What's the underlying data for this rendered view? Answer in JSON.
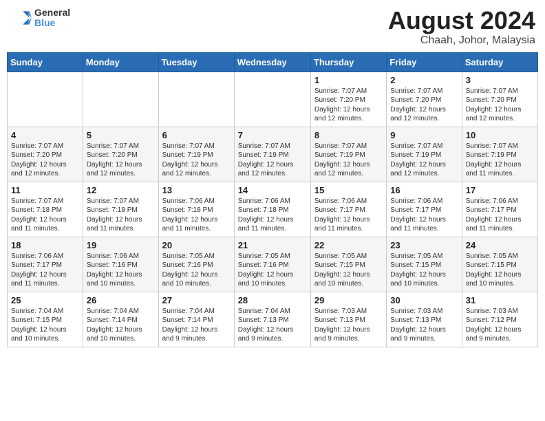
{
  "header": {
    "logo_line1": "General",
    "logo_line2": "Blue",
    "month": "August 2024",
    "location": "Chaah, Johor, Malaysia"
  },
  "weekdays": [
    "Sunday",
    "Monday",
    "Tuesday",
    "Wednesday",
    "Thursday",
    "Friday",
    "Saturday"
  ],
  "weeks": [
    [
      {
        "day": "",
        "info": ""
      },
      {
        "day": "",
        "info": ""
      },
      {
        "day": "",
        "info": ""
      },
      {
        "day": "",
        "info": ""
      },
      {
        "day": "1",
        "info": "Sunrise: 7:07 AM\nSunset: 7:20 PM\nDaylight: 12 hours\nand 12 minutes."
      },
      {
        "day": "2",
        "info": "Sunrise: 7:07 AM\nSunset: 7:20 PM\nDaylight: 12 hours\nand 12 minutes."
      },
      {
        "day": "3",
        "info": "Sunrise: 7:07 AM\nSunset: 7:20 PM\nDaylight: 12 hours\nand 12 minutes."
      }
    ],
    [
      {
        "day": "4",
        "info": "Sunrise: 7:07 AM\nSunset: 7:20 PM\nDaylight: 12 hours\nand 12 minutes."
      },
      {
        "day": "5",
        "info": "Sunrise: 7:07 AM\nSunset: 7:20 PM\nDaylight: 12 hours\nand 12 minutes."
      },
      {
        "day": "6",
        "info": "Sunrise: 7:07 AM\nSunset: 7:19 PM\nDaylight: 12 hours\nand 12 minutes."
      },
      {
        "day": "7",
        "info": "Sunrise: 7:07 AM\nSunset: 7:19 PM\nDaylight: 12 hours\nand 12 minutes."
      },
      {
        "day": "8",
        "info": "Sunrise: 7:07 AM\nSunset: 7:19 PM\nDaylight: 12 hours\nand 12 minutes."
      },
      {
        "day": "9",
        "info": "Sunrise: 7:07 AM\nSunset: 7:19 PM\nDaylight: 12 hours\nand 12 minutes."
      },
      {
        "day": "10",
        "info": "Sunrise: 7:07 AM\nSunset: 7:19 PM\nDaylight: 12 hours\nand 11 minutes."
      }
    ],
    [
      {
        "day": "11",
        "info": "Sunrise: 7:07 AM\nSunset: 7:18 PM\nDaylight: 12 hours\nand 11 minutes."
      },
      {
        "day": "12",
        "info": "Sunrise: 7:07 AM\nSunset: 7:18 PM\nDaylight: 12 hours\nand 11 minutes."
      },
      {
        "day": "13",
        "info": "Sunrise: 7:06 AM\nSunset: 7:18 PM\nDaylight: 12 hours\nand 11 minutes."
      },
      {
        "day": "14",
        "info": "Sunrise: 7:06 AM\nSunset: 7:18 PM\nDaylight: 12 hours\nand 11 minutes."
      },
      {
        "day": "15",
        "info": "Sunrise: 7:06 AM\nSunset: 7:17 PM\nDaylight: 12 hours\nand 11 minutes."
      },
      {
        "day": "16",
        "info": "Sunrise: 7:06 AM\nSunset: 7:17 PM\nDaylight: 12 hours\nand 11 minutes."
      },
      {
        "day": "17",
        "info": "Sunrise: 7:06 AM\nSunset: 7:17 PM\nDaylight: 12 hours\nand 11 minutes."
      }
    ],
    [
      {
        "day": "18",
        "info": "Sunrise: 7:06 AM\nSunset: 7:17 PM\nDaylight: 12 hours\nand 11 minutes."
      },
      {
        "day": "19",
        "info": "Sunrise: 7:06 AM\nSunset: 7:16 PM\nDaylight: 12 hours\nand 10 minutes."
      },
      {
        "day": "20",
        "info": "Sunrise: 7:05 AM\nSunset: 7:16 PM\nDaylight: 12 hours\nand 10 minutes."
      },
      {
        "day": "21",
        "info": "Sunrise: 7:05 AM\nSunset: 7:16 PM\nDaylight: 12 hours\nand 10 minutes."
      },
      {
        "day": "22",
        "info": "Sunrise: 7:05 AM\nSunset: 7:15 PM\nDaylight: 12 hours\nand 10 minutes."
      },
      {
        "day": "23",
        "info": "Sunrise: 7:05 AM\nSunset: 7:15 PM\nDaylight: 12 hours\nand 10 minutes."
      },
      {
        "day": "24",
        "info": "Sunrise: 7:05 AM\nSunset: 7:15 PM\nDaylight: 12 hours\nand 10 minutes."
      }
    ],
    [
      {
        "day": "25",
        "info": "Sunrise: 7:04 AM\nSunset: 7:15 PM\nDaylight: 12 hours\nand 10 minutes."
      },
      {
        "day": "26",
        "info": "Sunrise: 7:04 AM\nSunset: 7:14 PM\nDaylight: 12 hours\nand 10 minutes."
      },
      {
        "day": "27",
        "info": "Sunrise: 7:04 AM\nSunset: 7:14 PM\nDaylight: 12 hours\nand 9 minutes."
      },
      {
        "day": "28",
        "info": "Sunrise: 7:04 AM\nSunset: 7:13 PM\nDaylight: 12 hours\nand 9 minutes."
      },
      {
        "day": "29",
        "info": "Sunrise: 7:03 AM\nSunset: 7:13 PM\nDaylight: 12 hours\nand 9 minutes."
      },
      {
        "day": "30",
        "info": "Sunrise: 7:03 AM\nSunset: 7:13 PM\nDaylight: 12 hours\nand 9 minutes."
      },
      {
        "day": "31",
        "info": "Sunrise: 7:03 AM\nSunset: 7:12 PM\nDaylight: 12 hours\nand 9 minutes."
      }
    ]
  ]
}
